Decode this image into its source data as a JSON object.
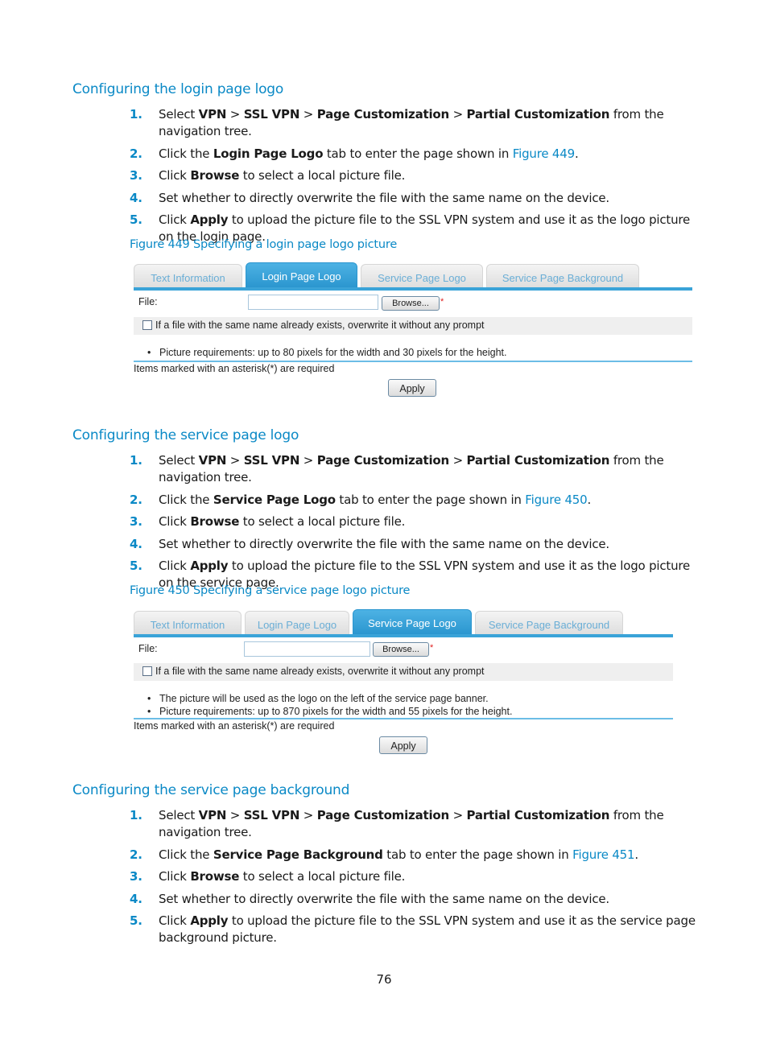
{
  "sections": [
    {
      "heading": "Configuring the login page logo",
      "steps": [
        {
          "num": "1.",
          "parts": [
            "Select ",
            "VPN",
            " > ",
            "SSL VPN",
            " > ",
            "Page Customization",
            " > ",
            "Partial Customization",
            " from the navigation tree."
          ]
        },
        {
          "num": "2.",
          "parts": [
            "Click the ",
            "Login Page Logo",
            " tab to enter the page shown in ",
            "Figure 449",
            "."
          ]
        },
        {
          "num": "3.",
          "parts": [
            "Click ",
            "Browse",
            " to select a local picture file."
          ]
        },
        {
          "num": "4.",
          "parts": [
            "Set whether to directly overwrite the file with the same name on the device."
          ]
        },
        {
          "num": "5.",
          "parts": [
            "Click ",
            "Apply",
            " to upload the picture file to the SSL VPN system and use it as the logo picture on the login page."
          ]
        }
      ],
      "figure_caption": "Figure 449 Specifying a login page logo picture"
    },
    {
      "heading": "Configuring the service page logo",
      "steps": [
        {
          "num": "1.",
          "parts": [
            "Select ",
            "VPN",
            " > ",
            "SSL VPN",
            " > ",
            "Page Customization",
            " > ",
            "Partial Customization",
            " from the navigation tree."
          ]
        },
        {
          "num": "2.",
          "parts": [
            "Click the ",
            "Service Page Logo",
            " tab to enter the page shown in ",
            "Figure 450",
            "."
          ]
        },
        {
          "num": "3.",
          "parts": [
            "Click ",
            "Browse",
            " to select a local picture file."
          ]
        },
        {
          "num": "4.",
          "parts": [
            "Set whether to directly overwrite the file with the same name on the device."
          ]
        },
        {
          "num": "5.",
          "parts": [
            "Click ",
            "Apply",
            " to upload the picture file to the SSL VPN system and use it as the logo picture on the service page."
          ]
        }
      ],
      "figure_caption": "Figure 450 Specifying a service page logo picture"
    },
    {
      "heading": "Configuring the service page background",
      "steps": [
        {
          "num": "1.",
          "parts": [
            "Select ",
            "VPN",
            " > ",
            "SSL VPN",
            " > ",
            "Page Customization",
            " > ",
            "Partial Customization",
            " from the navigation tree."
          ]
        },
        {
          "num": "2.",
          "parts": [
            "Click the ",
            "Service Page Background",
            " tab to enter the page shown in ",
            "Figure 451",
            "."
          ]
        },
        {
          "num": "3.",
          "parts": [
            "Click ",
            "Browse",
            " to select a local picture file."
          ]
        },
        {
          "num": "4.",
          "parts": [
            "Set whether to directly overwrite the file with the same name on the device."
          ]
        },
        {
          "num": "5.",
          "parts": [
            "Click ",
            "Apply",
            " to upload the picture file to the SSL VPN system and use it as the service page background picture."
          ]
        }
      ]
    }
  ],
  "figures": [
    {
      "tabs": [
        "Text Information",
        "Login Page Logo",
        "Service Page Logo",
        "Service Page Background"
      ],
      "active_tab": "Login Page Logo",
      "file_label": "File:",
      "file_value": "",
      "browse_label": "Browse...",
      "required_mark": "*",
      "overwrite_label": "If a file with the same name already exists, overwrite it without any prompt",
      "overwrite_checked": false,
      "notes": [
        "Picture requirements: up to 80 pixels for the width and 30 pixels for the height."
      ],
      "required_note": "Items marked with an asterisk(*) are required",
      "apply_label": "Apply"
    },
    {
      "tabs": [
        "Text Information",
        "Login Page Logo",
        "Service Page Logo",
        "Service Page Background"
      ],
      "active_tab": "Service Page Logo",
      "file_label": "File:",
      "file_value": "",
      "browse_label": "Browse...",
      "required_mark": "*",
      "overwrite_label": "If a file with the same name already exists, overwrite it without any prompt",
      "overwrite_checked": false,
      "notes": [
        "The picture will be used as the logo on the left of the service page banner.",
        "Picture requirements: up to 870 pixels for the width and 55 pixels for the height."
      ],
      "required_note": "Items marked with an asterisk(*) are required",
      "apply_label": "Apply"
    }
  ],
  "page_number": "76",
  "colors": {
    "accent": "#0a89c6",
    "tab_active": "#2b96cf",
    "tab_inactive_text": "#6aaed6",
    "required": "#e02020"
  }
}
